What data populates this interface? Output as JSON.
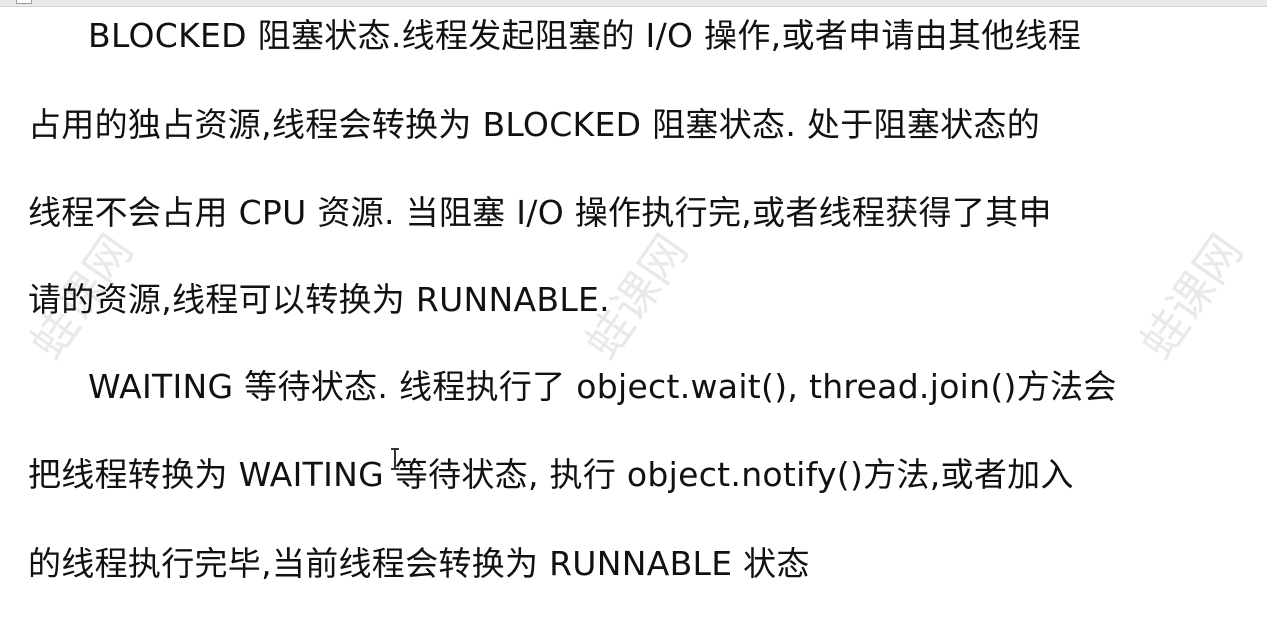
{
  "document": {
    "lines": [
      "BLOCKED 阻塞状态.线程发起阻塞的 I/O 操作,或者申请由其他线程",
      "占用的独占资源,线程会转换为 BLOCKED 阻塞状态. 处于阻塞状态的",
      "线程不会占用 CPU 资源. 当阻塞 I/O 操作执行完,或者线程获得了其申",
      "请的资源,线程可以转换为 RUNNABLE.",
      "WAITING 等待状态. 线程执行了 object.wait(), thread.join()方法会",
      "把线程转换为 WAITING 等待状态, 执行 object.notify()方法,或者加入",
      "的线程执行完毕,当前线程会转换为 RUNNABLE 状态"
    ]
  },
  "watermark": {
    "text": "蛙课网"
  }
}
